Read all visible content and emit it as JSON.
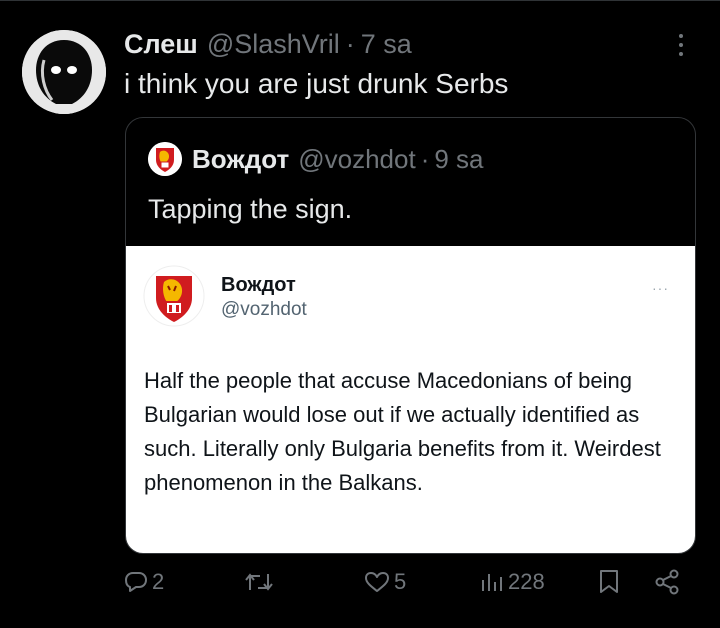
{
  "tweet": {
    "display_name": "Слеш",
    "handle": "@SlashVril",
    "separator": "·",
    "time": "7 sa",
    "text": "i think you are just drunk Serbs"
  },
  "quoted": {
    "display_name": "Вождот",
    "handle": "@vozhdot",
    "separator": "·",
    "time": "9 sa",
    "text": "Tapping the sign."
  },
  "embedded_screenshot": {
    "display_name": "Вождот",
    "handle": "@vozhdot",
    "more": "···",
    "body": "Half the people that accuse Macedonians of being Bulgarian would lose out if we actually identified as such. Literally only Bulgaria benefits from it. Weirdest phenomenon in the Balkans."
  },
  "actions": {
    "reply_count": "2",
    "retweet_count": "",
    "like_count": "5",
    "view_count": "228"
  },
  "colors": {
    "background": "#000000",
    "primary_text": "#e7e9ea",
    "secondary_text": "#71767b",
    "border": "#333639"
  },
  "icons": [
    "more-vertical-icon",
    "reply-icon",
    "retweet-icon",
    "like-icon",
    "views-icon",
    "bookmark-icon",
    "share-icon",
    "avatar-ghost",
    "avatar-lion-emblem"
  ]
}
